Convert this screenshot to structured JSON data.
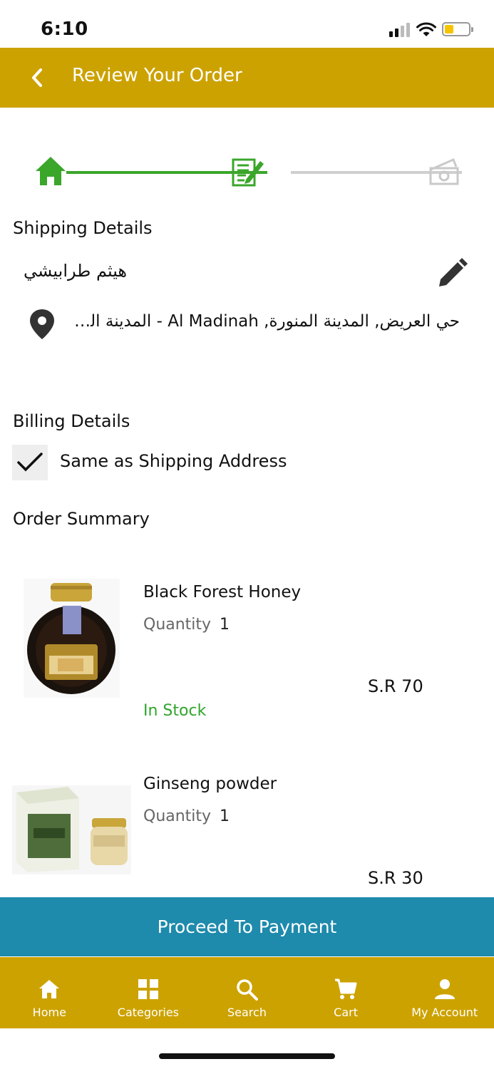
{
  "status_bar": {
    "time": "6:10"
  },
  "header": {
    "title": "Review Your Order"
  },
  "stepper": {
    "steps": [
      "home-icon",
      "review-icon",
      "payment-icon"
    ],
    "current_step": 2
  },
  "shipping": {
    "title": "Shipping Details",
    "name": "هيثم طرابيشي",
    "address": "حي العريض, المدينة المنورة, Al Madinah - المدينة المنورة,..."
  },
  "billing": {
    "title": "Billing Details",
    "same_as_shipping_label": "Same as Shipping Address",
    "same_as_shipping_checked": true
  },
  "order_summary": {
    "title": "Order Summary",
    "quantity_label": "Quantity",
    "items": [
      {
        "name": "Black Forest Honey",
        "quantity": "1",
        "price": "S.R 70",
        "stock": "In Stock"
      },
      {
        "name": "Ginseng powder",
        "quantity": "1",
        "price": "S.R 30"
      }
    ]
  },
  "proceed_button": {
    "label": "Proceed To Payment"
  },
  "bottom_nav": {
    "items": [
      {
        "label": "Home",
        "icon": "home-icon"
      },
      {
        "label": "Categories",
        "icon": "grid-icon"
      },
      {
        "label": "Search",
        "icon": "search-icon"
      },
      {
        "label": "Cart",
        "icon": "cart-icon"
      },
      {
        "label": "My Account",
        "icon": "account-icon"
      }
    ]
  },
  "colors": {
    "brand_gold": "#cca200",
    "action_blue": "#1e8aac",
    "progress_green": "#3aa62a",
    "in_stock_green": "#2fa52a"
  }
}
